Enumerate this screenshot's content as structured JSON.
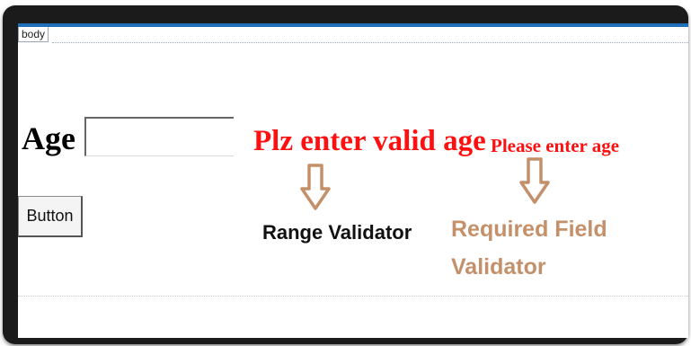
{
  "designer": {
    "body_tag": "body"
  },
  "form": {
    "age_label": "Age",
    "age_input_value": "",
    "button_label": "Button"
  },
  "validators": {
    "range_message": "Plz enter valid age",
    "required_message": "Please enter age",
    "range_caption": "Range Validator",
    "required_caption_line1": "Required Field",
    "required_caption_line2": "Validator"
  },
  "colors": {
    "error_text": "#ff1010",
    "arrow": "#c4906a",
    "required_caption": "#c4906a",
    "designer_accent": "#1f6fb8"
  },
  "icons": {
    "arrow": "down-arrow-icon"
  }
}
